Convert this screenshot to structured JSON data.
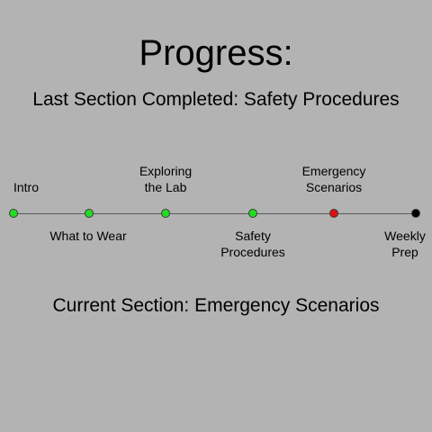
{
  "header": {
    "title": "Progress:",
    "last_completed": "Last Section Completed: Safety Procedures"
  },
  "timeline": {
    "steps": [
      {
        "label_line1": "Intro",
        "label_line2": "",
        "status": "completed",
        "color": "#22dd22"
      },
      {
        "label_line1": "What to Wear",
        "label_line2": "",
        "status": "completed",
        "color": "#22dd22"
      },
      {
        "label_line1": "Exploring",
        "label_line2": "the Lab",
        "status": "completed",
        "color": "#22dd22"
      },
      {
        "label_line1": "Safety",
        "label_line2": "Procedures",
        "status": "completed",
        "color": "#22dd22"
      },
      {
        "label_line1": "Emergency",
        "label_line2": "Scenarios",
        "status": "current",
        "color": "#dd1111"
      },
      {
        "label_line1": "Weekly",
        "label_line2": "Prep",
        "status": "upcoming",
        "color": "#000000"
      }
    ]
  },
  "footer": {
    "current_section": "Current Section: Emergency Scenarios"
  }
}
